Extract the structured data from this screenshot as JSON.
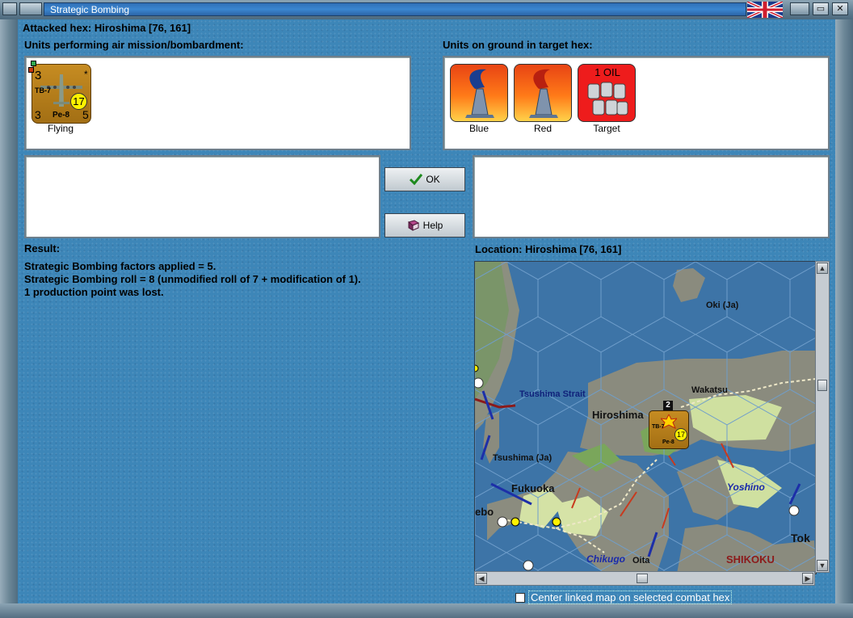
{
  "window": {
    "title": "Strategic Bombing"
  },
  "attacked_hex": "Attacked hex: Hiroshima  [76, 161]",
  "air_units": {
    "label": "Units performing air mission/bombardment:",
    "items": [
      {
        "caption": "Flying",
        "top_left": "3",
        "bottom_left": "3",
        "bottom_right": "5",
        "type_code": "TB-7",
        "name": "Pe-8",
        "badge": "17",
        "star": "*"
      }
    ]
  },
  "ground_units": {
    "label": "Units on ground in target hex:",
    "items": [
      {
        "caption": "Blue"
      },
      {
        "caption": "Red"
      },
      {
        "caption": "Target",
        "text": "1 OIL"
      }
    ]
  },
  "buttons": {
    "ok": "OK",
    "help": "Help"
  },
  "result": {
    "label": "Result:",
    "lines": [
      "Strategic Bombing factors applied = 5.",
      "Strategic Bombing roll = 8 (unmodified roll of 7 + modification of 1).",
      "1 production point was lost."
    ]
  },
  "location": {
    "label": "Location:  Hiroshima  [76, 161]",
    "map_labels": {
      "oki": "Oki (Ja)",
      "tsushima_strait": "Tsushima Strait",
      "wakatsu": "Wakatsu",
      "hiroshima": "Hiroshima",
      "tsushima": "Tsushima (Ja)",
      "fukuoka": "Fukuoka",
      "yoshino": "Yoshino",
      "chikugo": "Chikugo",
      "oita": "Oita",
      "shikoku": "SHIKOKU",
      "tok": "Tok",
      "ebo": "ebo"
    },
    "stack": {
      "count": "2",
      "type_code": "TB-7",
      "name": "Pe-8",
      "badge": "17"
    }
  },
  "center_option": {
    "label": "Center linked map on selected combat hex",
    "checked": false
  },
  "colors": {
    "panel_blue": "#3d86b8",
    "title_blue": "#3b86d0",
    "unit_brown": "#b07b1c",
    "target_red": "#ee1c1c",
    "city_yellow": "#ffee00"
  }
}
